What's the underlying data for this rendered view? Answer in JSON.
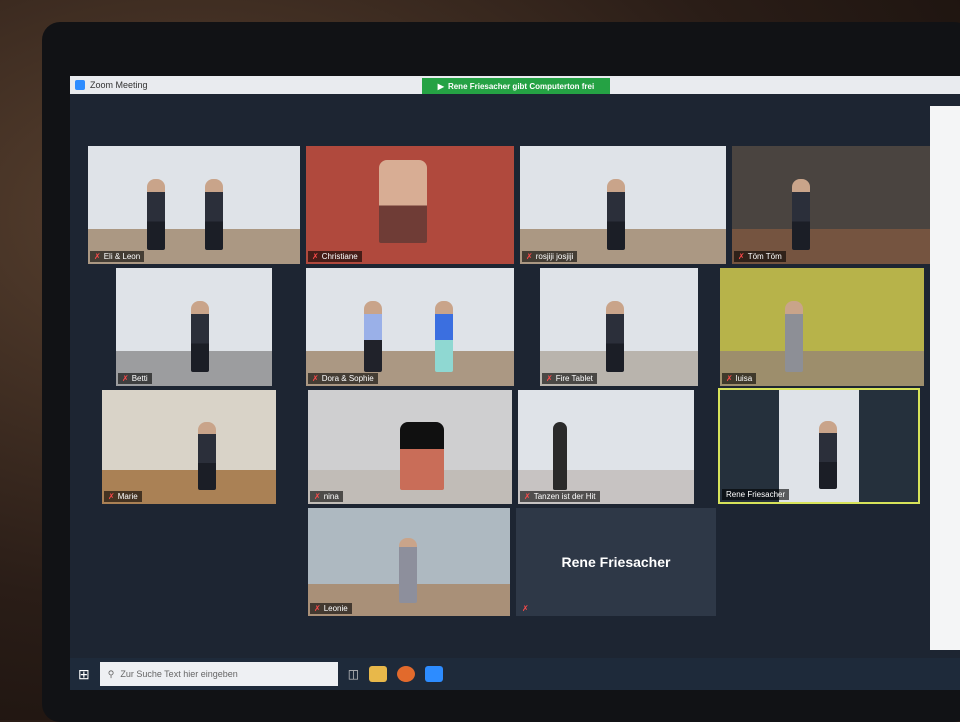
{
  "window": {
    "title": "Zoom Meeting"
  },
  "share_banner": "Rene Friesacher gibt Computerton frei",
  "participants": [
    "Eli & Leon",
    "Christiane",
    "rosjiji josjiji",
    "Töm Töm",
    "Betti",
    "Dora & Sophie",
    "Fire Tablet",
    "luisa",
    "Marie",
    "nina",
    "Tanzen ist der Hit",
    "Rene Friesacher",
    "Leonie"
  ],
  "name_only_tile": "Rene Friesacher",
  "taskbar": {
    "search_placeholder": "Zur Suche Text hier eingeben"
  },
  "colors": {
    "accent_green": "#25a244",
    "active_speaker": "#d7e35a",
    "zoom_blue": "#2d8cff"
  }
}
